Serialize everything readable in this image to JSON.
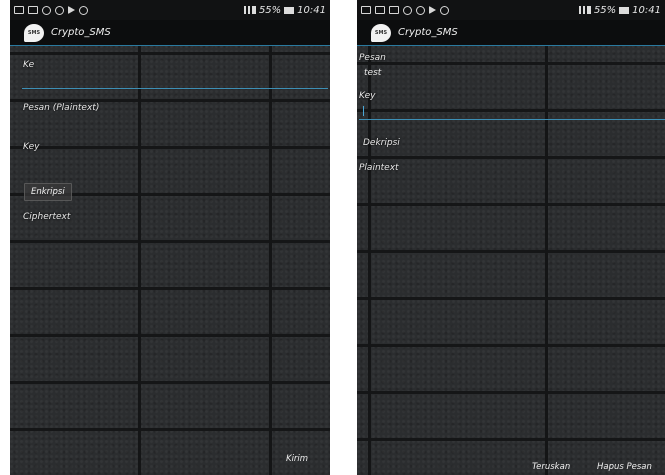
{
  "status": {
    "left": {
      "battery": "55%",
      "time": "10:41"
    },
    "right": {
      "battery": "55%",
      "time": "10:41"
    }
  },
  "app": {
    "title": "Crypto_SMS",
    "logo_text": "SMS"
  },
  "encrypt_screen": {
    "to_label": "Ke",
    "message_label": "Pesan (Plaintext)",
    "key_label": "Key",
    "encrypt_button": "Enkripsi",
    "ciphertext_label": "Ciphertext",
    "send_button": "Kirim"
  },
  "decrypt_screen": {
    "message_label": "Pesan",
    "message_value": "test",
    "key_label": "Key",
    "decrypt_button": "Dekripsi",
    "plaintext_label": "Plaintext",
    "forward_button": "Teruskan",
    "delete_button": "Hapus Pesan"
  },
  "colors": {
    "accent": "#3d8fb5",
    "bar": "#0c0d0e"
  }
}
